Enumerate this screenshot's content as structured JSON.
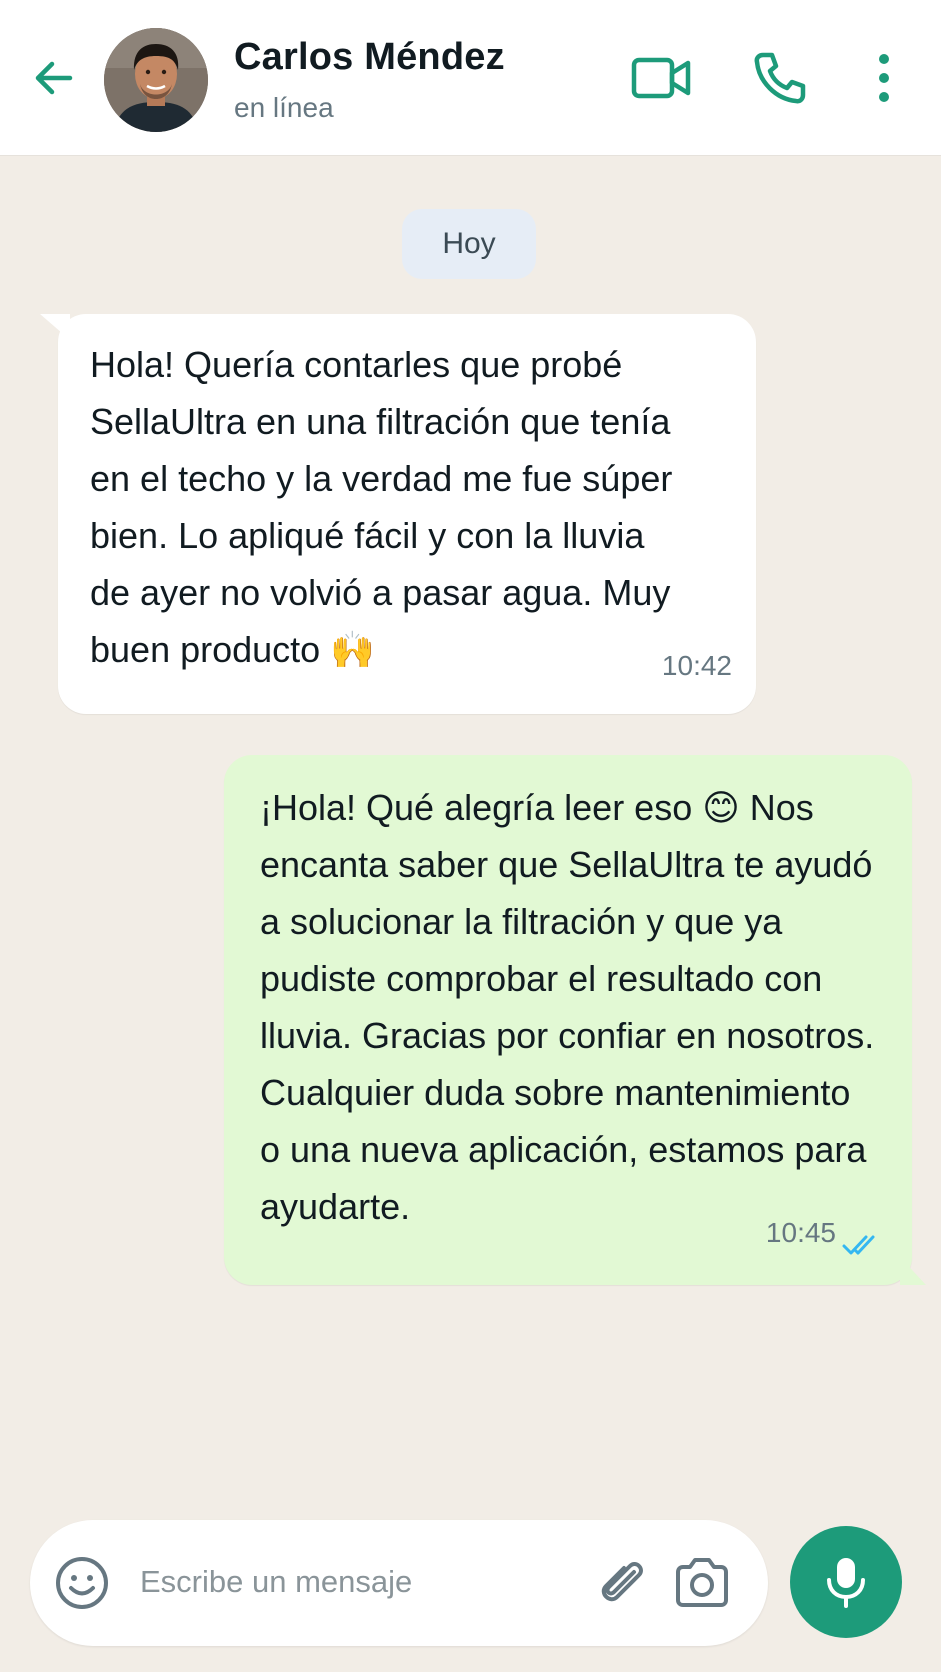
{
  "header": {
    "contact_name": "Carlos Méndez",
    "status": "en línea",
    "icons": {
      "back": "arrow-left-icon",
      "avatar": "avatar",
      "video": "video-camera-icon",
      "call": "phone-icon",
      "menu": "more-vertical-icon"
    }
  },
  "chat": {
    "date_chip": "Hoy",
    "messages": [
      {
        "direction": "incoming",
        "lines": [
          "Hola! Quería contarles que probé",
          "SellaUltra en una filtración que tenía",
          "en el techo y la verdad me fue súper",
          "bien. Lo apliqué fácil y con la lluvia",
          "de ayer no volvió a pasar agua. Muy",
          "buen producto 🙌"
        ],
        "time": "10:42"
      },
      {
        "direction": "outgoing",
        "lines": [
          "¡Hola! Qué alegría leer eso 😊 Nos",
          "encanta saber que SellaUltra te ayudó",
          "a solucionar la filtración y que ya",
          "pudiste comprobar el resultado con",
          "lluvia. Gracias por confiar en nosotros.",
          "Cualquier duda sobre mantenimiento",
          "o una nueva aplicación, estamos para",
          "ayudarte."
        ],
        "time": "10:45",
        "status_icon": "double-check-read-icon"
      }
    ]
  },
  "composer": {
    "placeholder": "Escribe un mensaje",
    "value": "",
    "icons": {
      "emoji": "emoji-icon",
      "attach": "paperclip-icon",
      "camera": "camera-icon",
      "mic": "microphone-icon"
    }
  },
  "colors": {
    "accent": "#1d9b7a",
    "chat_background": "#f2ede6",
    "incoming_bubble": "#ffffff",
    "outgoing_bubble": "#e2f9d4",
    "read_tick": "#34b7f1"
  }
}
